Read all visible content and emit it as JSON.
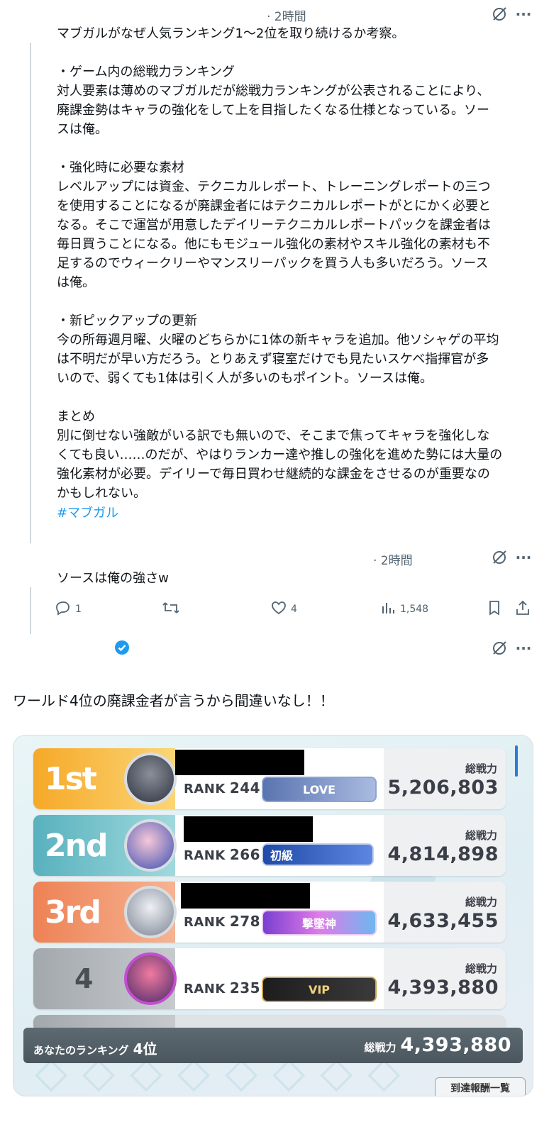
{
  "post1": {
    "time": "· 2時間",
    "paragraphs": [
      "マブガルがなぜ人気ランキング1～2位を取り続けるか考察。",
      "・ゲーム内の総戦力ランキング\n対人要素は薄めのマブガルだが総戦力ランキングが公表されることにより、\n廃課金勢はキャラの強化をして上を目指したくなる仕様となっている。ソー\nスは俺。",
      "・強化時に必要な素材\nレベルアップには資金、テクニカルレポート、トレーニングレポートの三つ\nを使用することになるが廃課金者にはテクニカルレポートがとにかく必要と\nなる。そこで運営が用意したデイリーテクニカルレポートパックを課金者は\n毎日買うことになる。他にもモジュール強化の素材やスキル強化の素材も不\n足するのでウィークリーやマンスリーパックを買う人も多いだろう。ソース\nは俺。",
      "・新ピックアップの更新\n今の所毎週月曜、火曜のどちらかに1体の新キャラを追加。他ソシャゲの平均\nは不明だが早い方だろう。とりあえず寝室だけでも見たいスケベ指揮官が多\nいので、弱くても1体は引く人が多いのもポイント。ソースは俺。",
      "まとめ\n別に倒せない強敵がいる訳でも無いので、そこまで焦ってキャラを強化しな\nくても良い……のだが、やはりランカー達や推しの強化を進めた勢には大量の\n強化素材が必要。デイリーで毎日買わせ継続的な課金をさせるのが重要なの\nかもしれない。"
    ],
    "hashtag": "#マブガル"
  },
  "post2": {
    "time": "· 2時間",
    "text": "ソースは俺の強さw",
    "actions": {
      "reply_count": "1",
      "like_count": "4",
      "views": "1,548"
    }
  },
  "post3": {
    "text": "ワールド4位の廃課金者が言うから間違いなし！！"
  },
  "ranking": {
    "power_label": "総戦力",
    "rank_label": "RANK",
    "rows": [
      {
        "place": "1st",
        "rank": "244",
        "badge": "LOVE",
        "power": "5,206,803",
        "color_from": "#f7b23a",
        "color_to": "#fbd97a",
        "badge_color": "#6d84b8"
      },
      {
        "place": "2nd",
        "rank": "266",
        "badge": "初級",
        "power": "4,814,898",
        "color_from": "#5fb7c2",
        "color_to": "#a3dde2",
        "badge_color": "#2f57b3"
      },
      {
        "place": "3rd",
        "rank": "278",
        "badge": "撃墜神",
        "power": "4,633,455",
        "color_from": "#ef8a5c",
        "color_to": "#f6b696",
        "badge_color": "#a34fd6"
      },
      {
        "place": "4",
        "rank": "235",
        "badge": "VIP",
        "power": "4,393,880",
        "color_from": "#a9aeb3",
        "color_to": "#c7cbcf",
        "badge_color": "#2b2b2b"
      }
    ],
    "footer": {
      "your_rank_label": "あなたのランキング",
      "your_rank": "4位",
      "power_label": "総戦力",
      "power": "4,393,880"
    },
    "rewards_button": "到達報酬一覧"
  }
}
